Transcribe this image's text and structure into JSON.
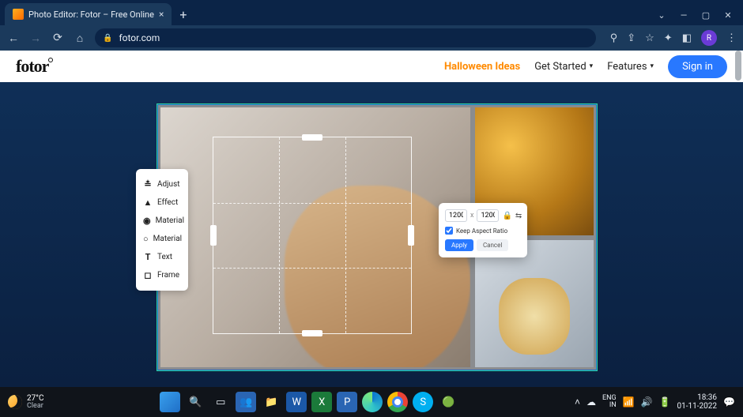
{
  "browser": {
    "tab_title": "Photo Editor: Fotor – Free Online",
    "url": "fotor.com",
    "profile_initial": "R"
  },
  "site": {
    "logo": "fotor",
    "nav": {
      "halloween": "Halloween Ideas",
      "get_started": "Get Started",
      "features": "Features",
      "sign_in": "Sign in"
    }
  },
  "tools": [
    {
      "icon": "≛",
      "label": "Adjust"
    },
    {
      "icon": "▲",
      "label": "Effect"
    },
    {
      "icon": "◉",
      "label": "Material"
    },
    {
      "icon": "○",
      "label": "Material"
    },
    {
      "icon": "T",
      "label": "Text"
    },
    {
      "icon": "◻",
      "label": "Frame"
    }
  ],
  "resize": {
    "width": "1200",
    "x": "x",
    "height": "1200",
    "keep_ratio_label": "Keep Aspect Ratio",
    "apply": "Apply",
    "cancel": "Cancel"
  },
  "taskbar": {
    "weather_temp": "27°C",
    "weather_cond": "Clear",
    "lang_top": "ENG",
    "lang_bot": "IN",
    "time": "18:36",
    "date": "01-11-2022"
  }
}
